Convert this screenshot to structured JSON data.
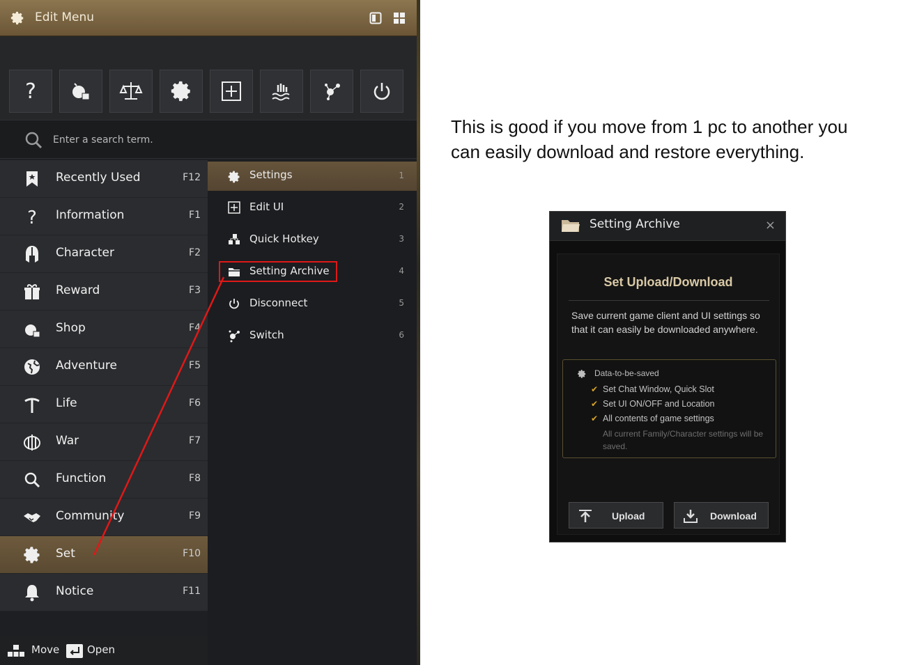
{
  "menu_window": {
    "title": "Edit Menu",
    "search_placeholder": "Enter a search term.",
    "top_icons": [
      "question-icon",
      "shop-icon",
      "balance-icon",
      "gear-icon",
      "edit-ui-icon",
      "life-icon",
      "switch-icon",
      "power-icon"
    ],
    "left_items": [
      {
        "label": "Recently Used",
        "key": "F12",
        "icon": "bookmark-icon"
      },
      {
        "label": "Information",
        "key": "F1",
        "icon": "question-icon"
      },
      {
        "label": "Character",
        "key": "F2",
        "icon": "helmet-icon"
      },
      {
        "label": "Reward",
        "key": "F3",
        "icon": "gift-icon"
      },
      {
        "label": "Shop",
        "key": "F4",
        "icon": "shop-icon"
      },
      {
        "label": "Adventure",
        "key": "F5",
        "icon": "globe-icon"
      },
      {
        "label": "Life",
        "key": "F6",
        "icon": "pickaxe-icon"
      },
      {
        "label": "War",
        "key": "F7",
        "icon": "war-icon"
      },
      {
        "label": "Function",
        "key": "F8",
        "icon": "magnifier-icon"
      },
      {
        "label": "Community",
        "key": "F9",
        "icon": "handshake-icon"
      },
      {
        "label": "Set",
        "key": "F10",
        "icon": "gear-icon",
        "active": true
      },
      {
        "label": "Notice",
        "key": "F11",
        "icon": "bell-icon"
      }
    ],
    "sub_items": [
      {
        "label": "Settings",
        "num": "1",
        "icon": "gear-icon",
        "active": true
      },
      {
        "label": "Edit UI",
        "num": "2",
        "icon": "edit-ui-icon"
      },
      {
        "label": "Quick Hotkey",
        "num": "3",
        "icon": "hotkey-icon"
      },
      {
        "label": "Setting Archive",
        "num": "4",
        "icon": "folder-icon",
        "highlighted": true
      },
      {
        "label": "Disconnect",
        "num": "5",
        "icon": "power-icon"
      },
      {
        "label": "Switch",
        "num": "6",
        "icon": "switch-icon"
      }
    ],
    "bottom": {
      "move": "Move",
      "open": "Open"
    }
  },
  "explanation": {
    "line1": "This is good if you move from 1 pc to another you",
    "line2": "can easily download and restore everything."
  },
  "archive_dialog": {
    "title": "Setting Archive",
    "close": "×",
    "heading": "Set Upload/Download",
    "desc": "Save current game client and UI settings so that it can easily be downloaded anywhere.",
    "data_head": "Data-to-be-saved",
    "data_items": [
      "Set Chat Window, Quick Slot",
      "Set UI ON/OFF and Location",
      "All contents of game settings"
    ],
    "data_note": "All current Family/Character settings will be saved.",
    "upload": "Upload",
    "download": "Download"
  },
  "colors": {
    "title_bar": "#7d6a48",
    "active_item": "#6a573c",
    "highlight_box": "#e01818",
    "archive_heading": "#d9c9a6",
    "check": "#d9a52a"
  }
}
